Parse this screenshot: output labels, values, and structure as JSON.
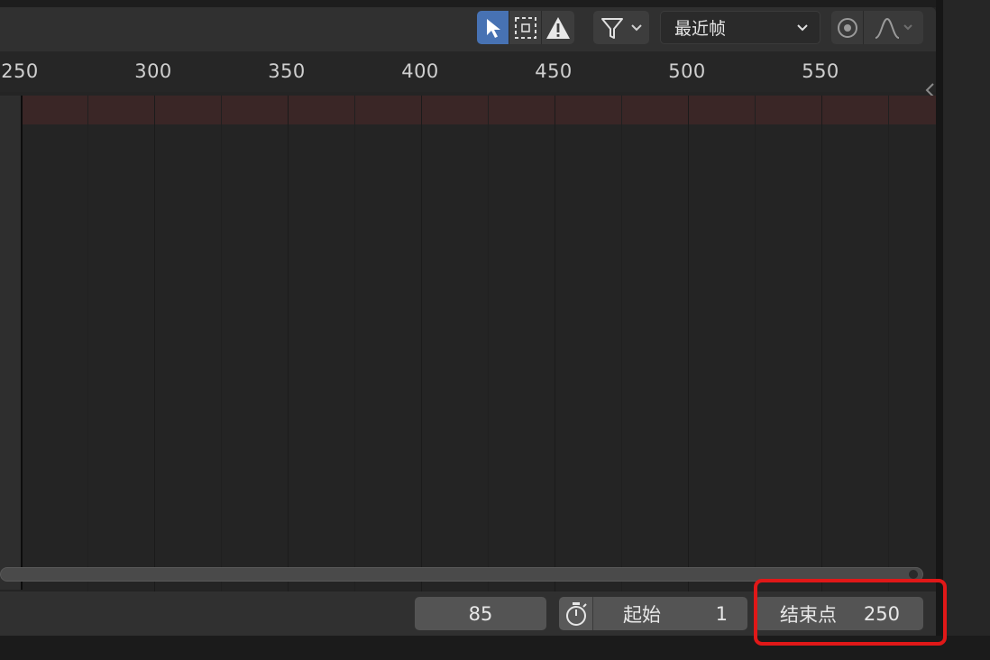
{
  "header": {
    "select_mode": [
      "select-arrow-icon",
      "box-select-icon",
      "warning-icon"
    ],
    "filter": {
      "icon": "filter-icon"
    },
    "snap_select": {
      "value": "最近帧"
    },
    "proportional": {
      "icons": [
        "proportional-circle-icon",
        "falloff-curve-icon"
      ]
    }
  },
  "ruler": {
    "ticks": [
      "250",
      "300",
      "350",
      "400",
      "450",
      "500",
      "550"
    ]
  },
  "footer": {
    "current_frame": "85",
    "start": {
      "label": "起始",
      "value": "1"
    },
    "end": {
      "label": "结束点",
      "value": "250"
    }
  },
  "colors": {
    "accent_active": "#4772b3",
    "highlight_box": "#e01818",
    "range_band": "#3a2626"
  }
}
